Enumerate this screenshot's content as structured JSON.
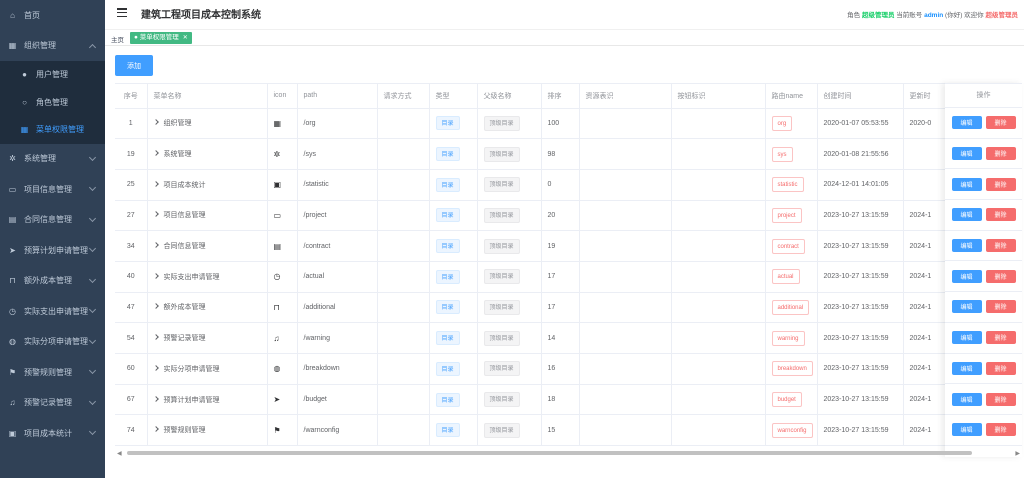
{
  "sidebar": {
    "items": [
      {
        "label": "首页",
        "icon": "home-icon"
      },
      {
        "label": "组织管理",
        "icon": "grid-icon",
        "expanded": true
      },
      {
        "label": "用户管理",
        "icon": "user-icon",
        "sub": true
      },
      {
        "label": "角色管理",
        "icon": "person-outline-icon",
        "sub": true
      },
      {
        "label": "菜单权限管理",
        "icon": "grid-icon",
        "sub": true,
        "active": true
      },
      {
        "label": "系统管理",
        "icon": "gear-icon"
      },
      {
        "label": "项目信息管理",
        "icon": "folder-icon"
      },
      {
        "label": "合同信息管理",
        "icon": "document-icon"
      },
      {
        "label": "预算计划申请管理",
        "icon": "send-icon"
      },
      {
        "label": "额外成本管理",
        "icon": "bag-icon"
      },
      {
        "label": "实际支出申请管理",
        "icon": "clock-icon"
      },
      {
        "label": "实际分项申请管理",
        "icon": "globe-icon"
      },
      {
        "label": "预警规则管理",
        "icon": "flag-icon"
      },
      {
        "label": "预警记录管理",
        "icon": "bell-icon"
      },
      {
        "label": "项目成本统计",
        "icon": "chart-icon"
      }
    ]
  },
  "navbar": {
    "title": "建筑工程项目成本控制系统",
    "user_prefix": "角色",
    "role": "超级管理员",
    "account_prefix": "当前账号",
    "account": "admin",
    "greeting": "(你好) 欢迎你",
    "name": "超级管理员"
  },
  "tags": {
    "home": "主页",
    "active": "菜单权限管理"
  },
  "actions": {
    "add_label": "添加"
  },
  "table": {
    "headers": [
      "序号",
      "菜单名称",
      "icon",
      "path",
      "请求方式",
      "类型",
      "父级名称",
      "排序",
      "资源表识",
      "按钮标识",
      "路由name",
      "创建时间",
      "更新时",
      "操作"
    ],
    "edit_label": "编辑",
    "delete_label": "删除",
    "rows": [
      {
        "id": "1",
        "name": "组织管理",
        "icon": "grid-icon",
        "path": "/org",
        "type": "目录",
        "parent": "顶级目录",
        "sort": "100",
        "route": "org",
        "created": "2020-01-07 05:53:55",
        "updated": "2020-0"
      },
      {
        "id": "19",
        "name": "系统管理",
        "icon": "gear-icon",
        "path": "/sys",
        "type": "目录",
        "parent": "顶级目录",
        "sort": "98",
        "route": "sys",
        "created": "2020-01-08 21:55:56",
        "updated": ""
      },
      {
        "id": "25",
        "name": "项目成本统计",
        "icon": "chart-icon",
        "path": "/statistic",
        "type": "目录",
        "parent": "顶级目录",
        "sort": "0",
        "route": "statistic",
        "created": "2024-12-01 14:01:05",
        "updated": ""
      },
      {
        "id": "27",
        "name": "项目信息管理",
        "icon": "folder-icon",
        "path": "/project",
        "type": "目录",
        "parent": "顶级目录",
        "sort": "20",
        "route": "project",
        "created": "2023-10-27 13:15:59",
        "updated": "2024-1"
      },
      {
        "id": "34",
        "name": "合同信息管理",
        "icon": "document-icon",
        "path": "/contract",
        "type": "目录",
        "parent": "顶级目录",
        "sort": "19",
        "route": "contract",
        "created": "2023-10-27 13:15:59",
        "updated": "2024-1"
      },
      {
        "id": "40",
        "name": "实际支出申请管理",
        "icon": "clock-icon",
        "path": "/actual",
        "type": "目录",
        "parent": "顶级目录",
        "sort": "17",
        "route": "actual",
        "created": "2023-10-27 13:15:59",
        "updated": "2024-1"
      },
      {
        "id": "47",
        "name": "额外成本管理",
        "icon": "bag-icon",
        "path": "/additional",
        "type": "目录",
        "parent": "顶级目录",
        "sort": "17",
        "route": "additional",
        "created": "2023-10-27 13:15:59",
        "updated": "2024-1"
      },
      {
        "id": "54",
        "name": "预警记录管理",
        "icon": "bell-icon",
        "path": "/warning",
        "type": "目录",
        "parent": "顶级目录",
        "sort": "14",
        "route": "warning",
        "created": "2023-10-27 13:15:59",
        "updated": "2024-1"
      },
      {
        "id": "60",
        "name": "实际分项申请管理",
        "icon": "globe-icon",
        "path": "/breakdown",
        "type": "目录",
        "parent": "顶级目录",
        "sort": "16",
        "route": "breakdown",
        "created": "2023-10-27 13:15:59",
        "updated": "2024-1"
      },
      {
        "id": "67",
        "name": "预算计划申请管理",
        "icon": "send-icon",
        "path": "/budget",
        "type": "目录",
        "parent": "顶级目录",
        "sort": "18",
        "route": "budget",
        "created": "2023-10-27 13:15:59",
        "updated": "2024-1"
      },
      {
        "id": "74",
        "name": "预警规则管理",
        "icon": "flag-icon",
        "path": "/warnconfig",
        "type": "目录",
        "parent": "顶级目录",
        "sort": "15",
        "route": "warnconfig",
        "created": "2023-10-27 13:15:59",
        "updated": "2024-1"
      }
    ]
  },
  "colors": {
    "sidebar_bg": "#304156",
    "primary": "#409eff",
    "danger": "#f56c6c",
    "success_tag": "#42b983"
  }
}
